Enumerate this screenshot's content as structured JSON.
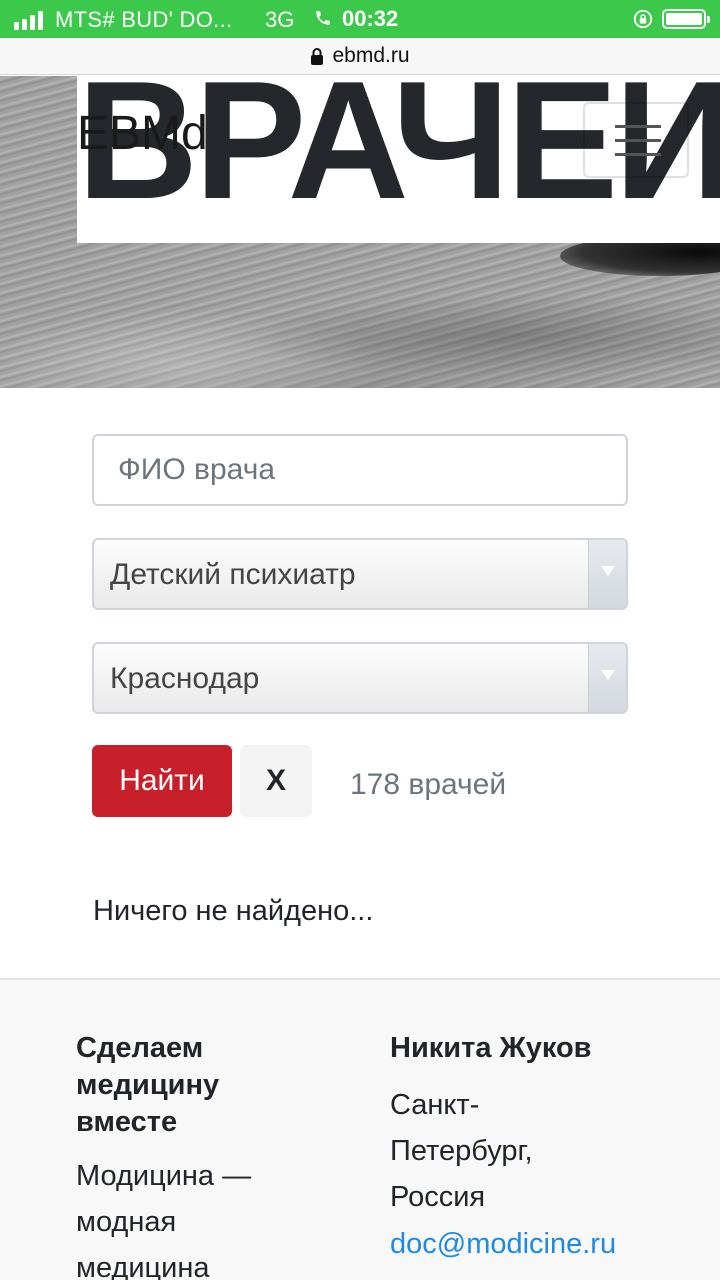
{
  "status_bar": {
    "carrier": "MTS# BUD' DO...",
    "network": "3G",
    "time": "00:32"
  },
  "url_bar": {
    "domain": "ebmd.ru"
  },
  "hero": {
    "big_word": "ВРАЧЕИ",
    "brand": "EBMd"
  },
  "search": {
    "name_placeholder": "ФИО врача",
    "name_value": "",
    "specialty_selected": "Детский психиатр",
    "city_selected": "Краснодар",
    "find_label": "Найти",
    "clear_label": "X",
    "doctor_count": "178 врачей",
    "empty_message": "Ничего не найдено..."
  },
  "footer": {
    "col1_heading_line1": "Сделаем",
    "col1_heading_line2": "медицину",
    "col1_heading_line3": "вместе",
    "col1_text_line1": "Модицина —",
    "col1_text_line2": "модная",
    "col1_text_line3": "медицина",
    "col2_heading": "Никита Жуков",
    "col2_addr_line1": "Санкт-",
    "col2_addr_line2": "Петербург,",
    "col2_addr_line3": "Россия",
    "col2_email": "doc@modicine.ru"
  },
  "colors": {
    "status_bar": "#3cc84a",
    "find_button": "#c8202a",
    "link": "#1e8ae6"
  }
}
